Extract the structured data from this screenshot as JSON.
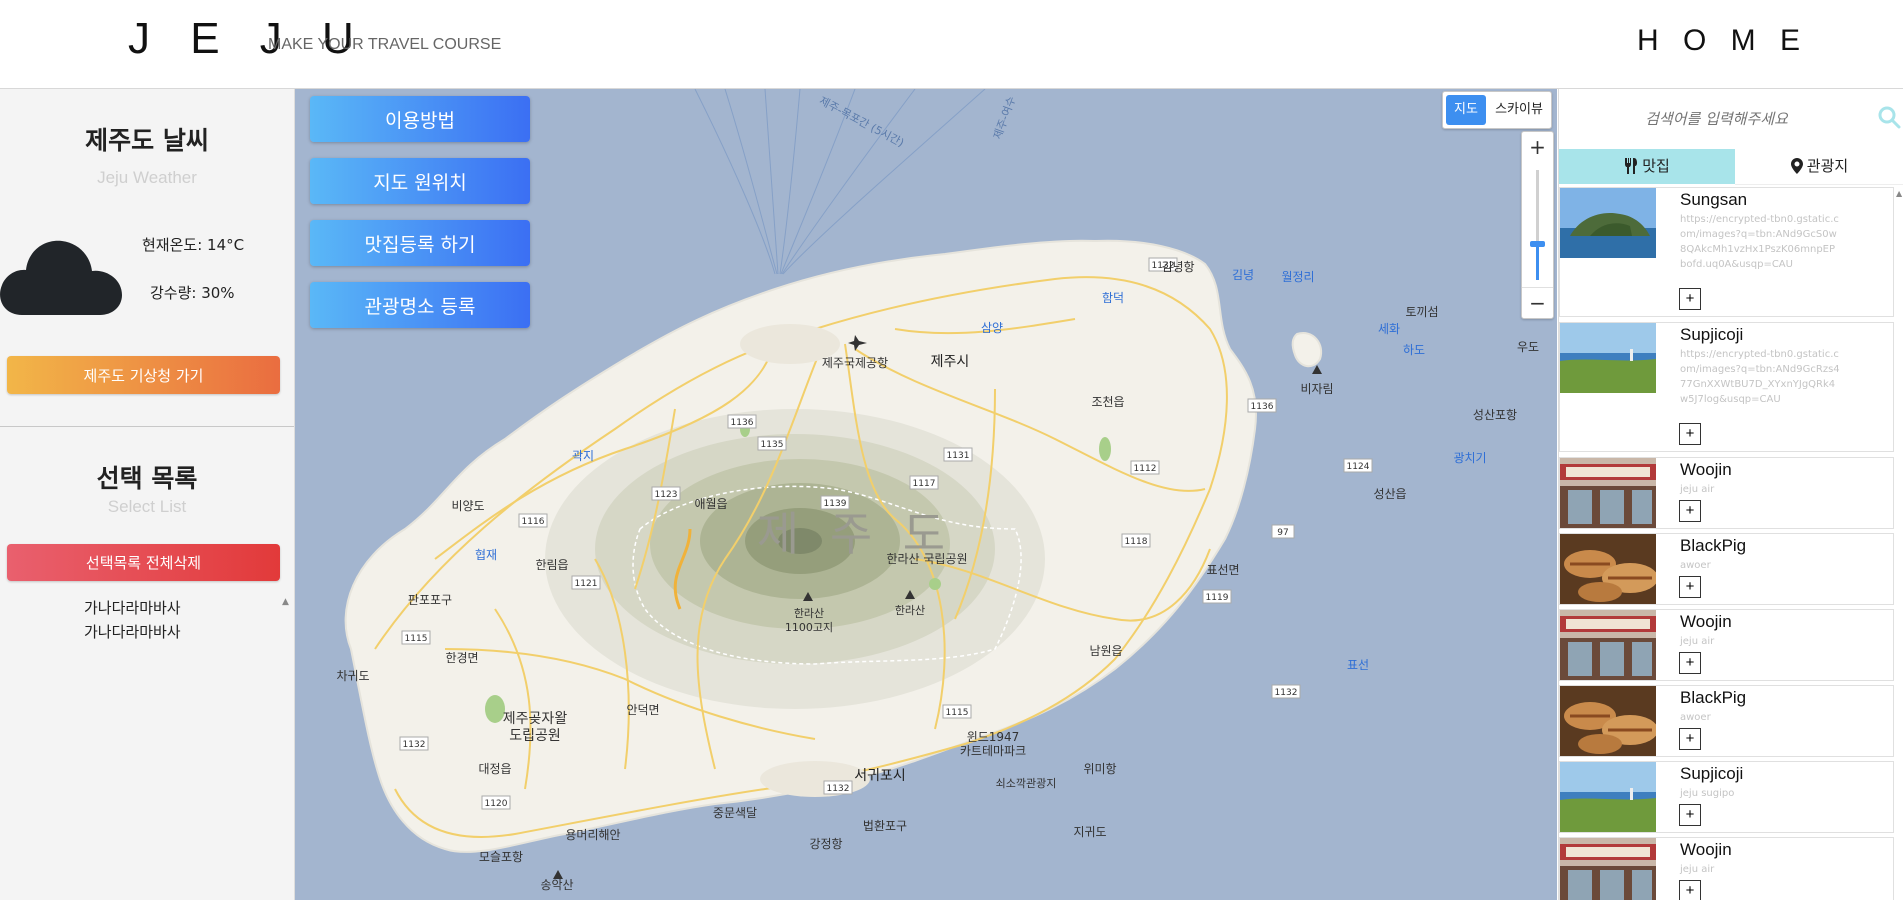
{
  "header": {
    "logo": "J E J U",
    "tagline": "MAKE YOUR TRAVEL COURSE",
    "home": "H O M E"
  },
  "weather": {
    "title": "제주도 날씨",
    "subtitle": "Jeju Weather",
    "temperature": "현재온도: 14°C",
    "precipitation": "강수량: 30%",
    "kma_button": "제주도 기상청 가기",
    "icon": "cloud-icon"
  },
  "selection": {
    "title": "선택 목록",
    "subtitle": "Select List",
    "delete_all": "선택목록 전체삭제",
    "items": [
      "가나다라마바사",
      "가나다라마바사"
    ]
  },
  "map": {
    "buttons": [
      "이용방법",
      "지도 원위치",
      "맛집등록 하기",
      "관광명소 등록"
    ],
    "type_map": "지도",
    "type_sky": "스카이뷰",
    "zoom_in": "+",
    "zoom_out": "−",
    "zoom_level": 0.3,
    "labels": {
      "island": "제 주 도",
      "jeju_city": "제주시",
      "airport": "제주국제공항",
      "seogwipo": "서귀포시",
      "hallasan_park": "한라산 국립공원",
      "hallasan": "한라산",
      "gimnyeong": "김녕항",
      "gimnyeong2": "김녕",
      "woljeongri": "월정리",
      "hamdeok": "함덕",
      "samyang": "삼양",
      "sehwa": "세화",
      "hado": "하도",
      "tokkiseom": "토끼섬",
      "udo": "우도",
      "bijarim": "비자림",
      "jocheon": "조천읍",
      "seongsanpo": "성산포항",
      "gwangchigi": "광치기",
      "seongsan": "성산읍",
      "pyoseon_myeon": "표선면",
      "pyoseon": "표선",
      "namwon": "남원읍",
      "wimi": "위미항",
      "soesokkak": "쇠소깍관광지",
      "jigwido": "지귀도",
      "aewol": "애월읍",
      "gwakji": "곽지",
      "biyangdo": "비양도",
      "hyeopjae": "협재",
      "hallim": "한림읍",
      "panpo": "판포포구",
      "chagwido": "차귀도",
      "hangyeong": "한경면",
      "gotjawal": "제주곶자왈",
      "gotjawal2": "도립공원",
      "andeok": "안덕면",
      "daejeong": "대정읍",
      "moseulpo": "모슬포항",
      "songaksan": "송악산",
      "yongmeori": "용머리해안",
      "jungmun": "중문색달",
      "gangjeong": "강정항",
      "beophwan": "법환포구",
      "windy": "윈드1947",
      "windy2": "카트테마파크",
      "peak_1100": "한라산",
      "peak_1100b": "1100고지",
      "route_a": "제주-목포간 (5시간)",
      "route_b": "제주-여수"
    },
    "roads": [
      "1132",
      "1136",
      "1135",
      "1131",
      "1139",
      "1117",
      "1123",
      "1116",
      "1121",
      "1115",
      "1132",
      "1120",
      "1132",
      "1115",
      "1112",
      "1136",
      "1124",
      "1118",
      "97",
      "1119",
      "1132"
    ]
  },
  "search": {
    "placeholder": "검색어를 입력해주세요"
  },
  "tabs": {
    "food": "맛집",
    "tour": "관광지"
  },
  "places": [
    {
      "name": "Sungsan",
      "desc": "https://encrypted-tbn0.gstatic.com/images?q=tbn:ANd9GcS0w8QAkcMh1vzHx1PszK06mnpEPbofd.uq0A&usqp=CAU",
      "thumb": "sungsan"
    },
    {
      "name": "Supjicoji",
      "desc": "https://encrypted-tbn0.gstatic.com/images?q=tbn:ANd9GcRzs477GnXXWtBU7D_XYxnYJgQRk4w5J7log&usqp=CAU",
      "thumb": "coast"
    },
    {
      "name": "Woojin",
      "desc": "jeju air",
      "thumb": "restaurant"
    },
    {
      "name": "BlackPig",
      "desc": "awoer",
      "thumb": "bbq"
    },
    {
      "name": "Woojin",
      "desc": "jeju air",
      "thumb": "restaurant"
    },
    {
      "name": "BlackPig",
      "desc": "awoer",
      "thumb": "bbq"
    },
    {
      "name": "Supjicoji",
      "desc": "jeju sugipo",
      "thumb": "coast"
    },
    {
      "name": "Woojin",
      "desc": "jeju air",
      "thumb": "restaurant"
    }
  ],
  "colors": {
    "accent_blue": "#3d8ff0",
    "tab_active": "#a8e4ea",
    "kma_gradient": [
      "#f2b648",
      "#ea6d40"
    ],
    "delete_gradient": [
      "#e9606e",
      "#e23a3a"
    ],
    "map_button_gradient": [
      "#5ab8f7",
      "#3b6ff3"
    ],
    "sea": "#a3b5cf",
    "land": "#f3f1ea"
  }
}
